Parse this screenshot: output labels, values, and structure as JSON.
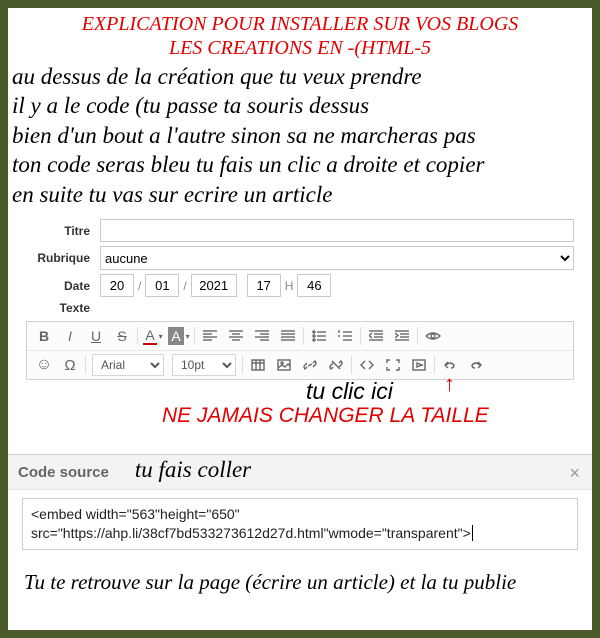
{
  "title": {
    "line1": "EXPLICATION POUR INSTALLER SUR VOS BLOGS",
    "line2": "LES CREATIONS EN -(HTML-5"
  },
  "intro": {
    "l1": "au dessus de la création que tu veux prendre",
    "l2": "il y a le code (tu passe ta souris dessus",
    "l3a": "bien d'un bout a l'autre ",
    "l3b": "sinon sa ne ",
    "l3c": "marcheras pas",
    "l4a": "ton code seras bleu ",
    "l4b": "tu fais un clic a droite et copier",
    "l5": "en suite tu vas sur ecrire un article"
  },
  "form": {
    "titre_label": "Titre",
    "rubrique_label": "Rubrique",
    "rubrique_value": "aucune",
    "date_label": "Date",
    "day": "20",
    "month": "01",
    "year": "2021",
    "hour": "17",
    "h_sep": "H",
    "minute": "46",
    "texte_label": "Texte"
  },
  "toolbar": {
    "bold": "B",
    "italic": "I",
    "underline": "U",
    "strike": "S",
    "letterA1": "A",
    "letterA2": "A",
    "smile": "☺",
    "omega": "Ω",
    "font_value": "Arial",
    "size_value": "10pt"
  },
  "annotations": {
    "clic_ici": "tu clic ici",
    "ne_jamais": "NE JAMAIS CHANGER LA TAILLE",
    "arrow": "↑"
  },
  "codesource": {
    "label": "Code source",
    "coller": "tu fais coller",
    "close": "×",
    "content": "<embed width=\"563\"height=\"650\" src=\"https://ahp.li/38cf7bd533273612d27d.html\"wmode=\"transparent\">"
  },
  "final": "Tu te retrouve sur la page (écrire un article) et la tu publie"
}
